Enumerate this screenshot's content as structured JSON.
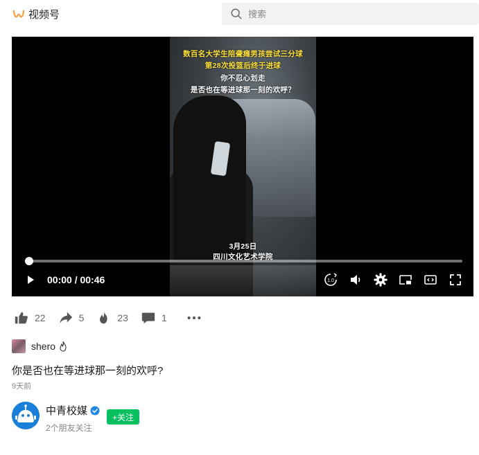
{
  "header": {
    "app_name": "视频号",
    "logo_icon": "channels-logo-icon",
    "search_placeholder": "搜索",
    "accent_color": "#fa9d3b"
  },
  "video": {
    "captions_top": [
      "数百名大学生陪聋瘫男孩尝试三分球",
      "第28次投篮后终于进球"
    ],
    "captions_mid": [
      "你不忍心划走",
      "是否也在等进球那一刻的欢呼？"
    ],
    "caption_date": "3月25日",
    "caption_school": "四川文化艺术学院",
    "current_time": "00:00 / 00:46",
    "progress_fraction": 0.0,
    "speed_label": "1.0",
    "controls": [
      "play-icon",
      "speed-icon",
      "volume-icon",
      "settings-icon",
      "mini-player-icon",
      "web-fullscreen-icon",
      "fullscreen-icon"
    ]
  },
  "actions": {
    "like_count": "22",
    "share_count": "5",
    "hot_count": "23",
    "comment_count": "1"
  },
  "author": {
    "name": "shero"
  },
  "post": {
    "description": "你是否也在等进球那一刻的欢呼?",
    "time_ago": "9天前"
  },
  "account": {
    "name": "中青校媒",
    "friends_following": "2个朋友关注",
    "follow_label": "+关注",
    "follow_color": "#07c160",
    "verified_color": "#1e88e5"
  }
}
